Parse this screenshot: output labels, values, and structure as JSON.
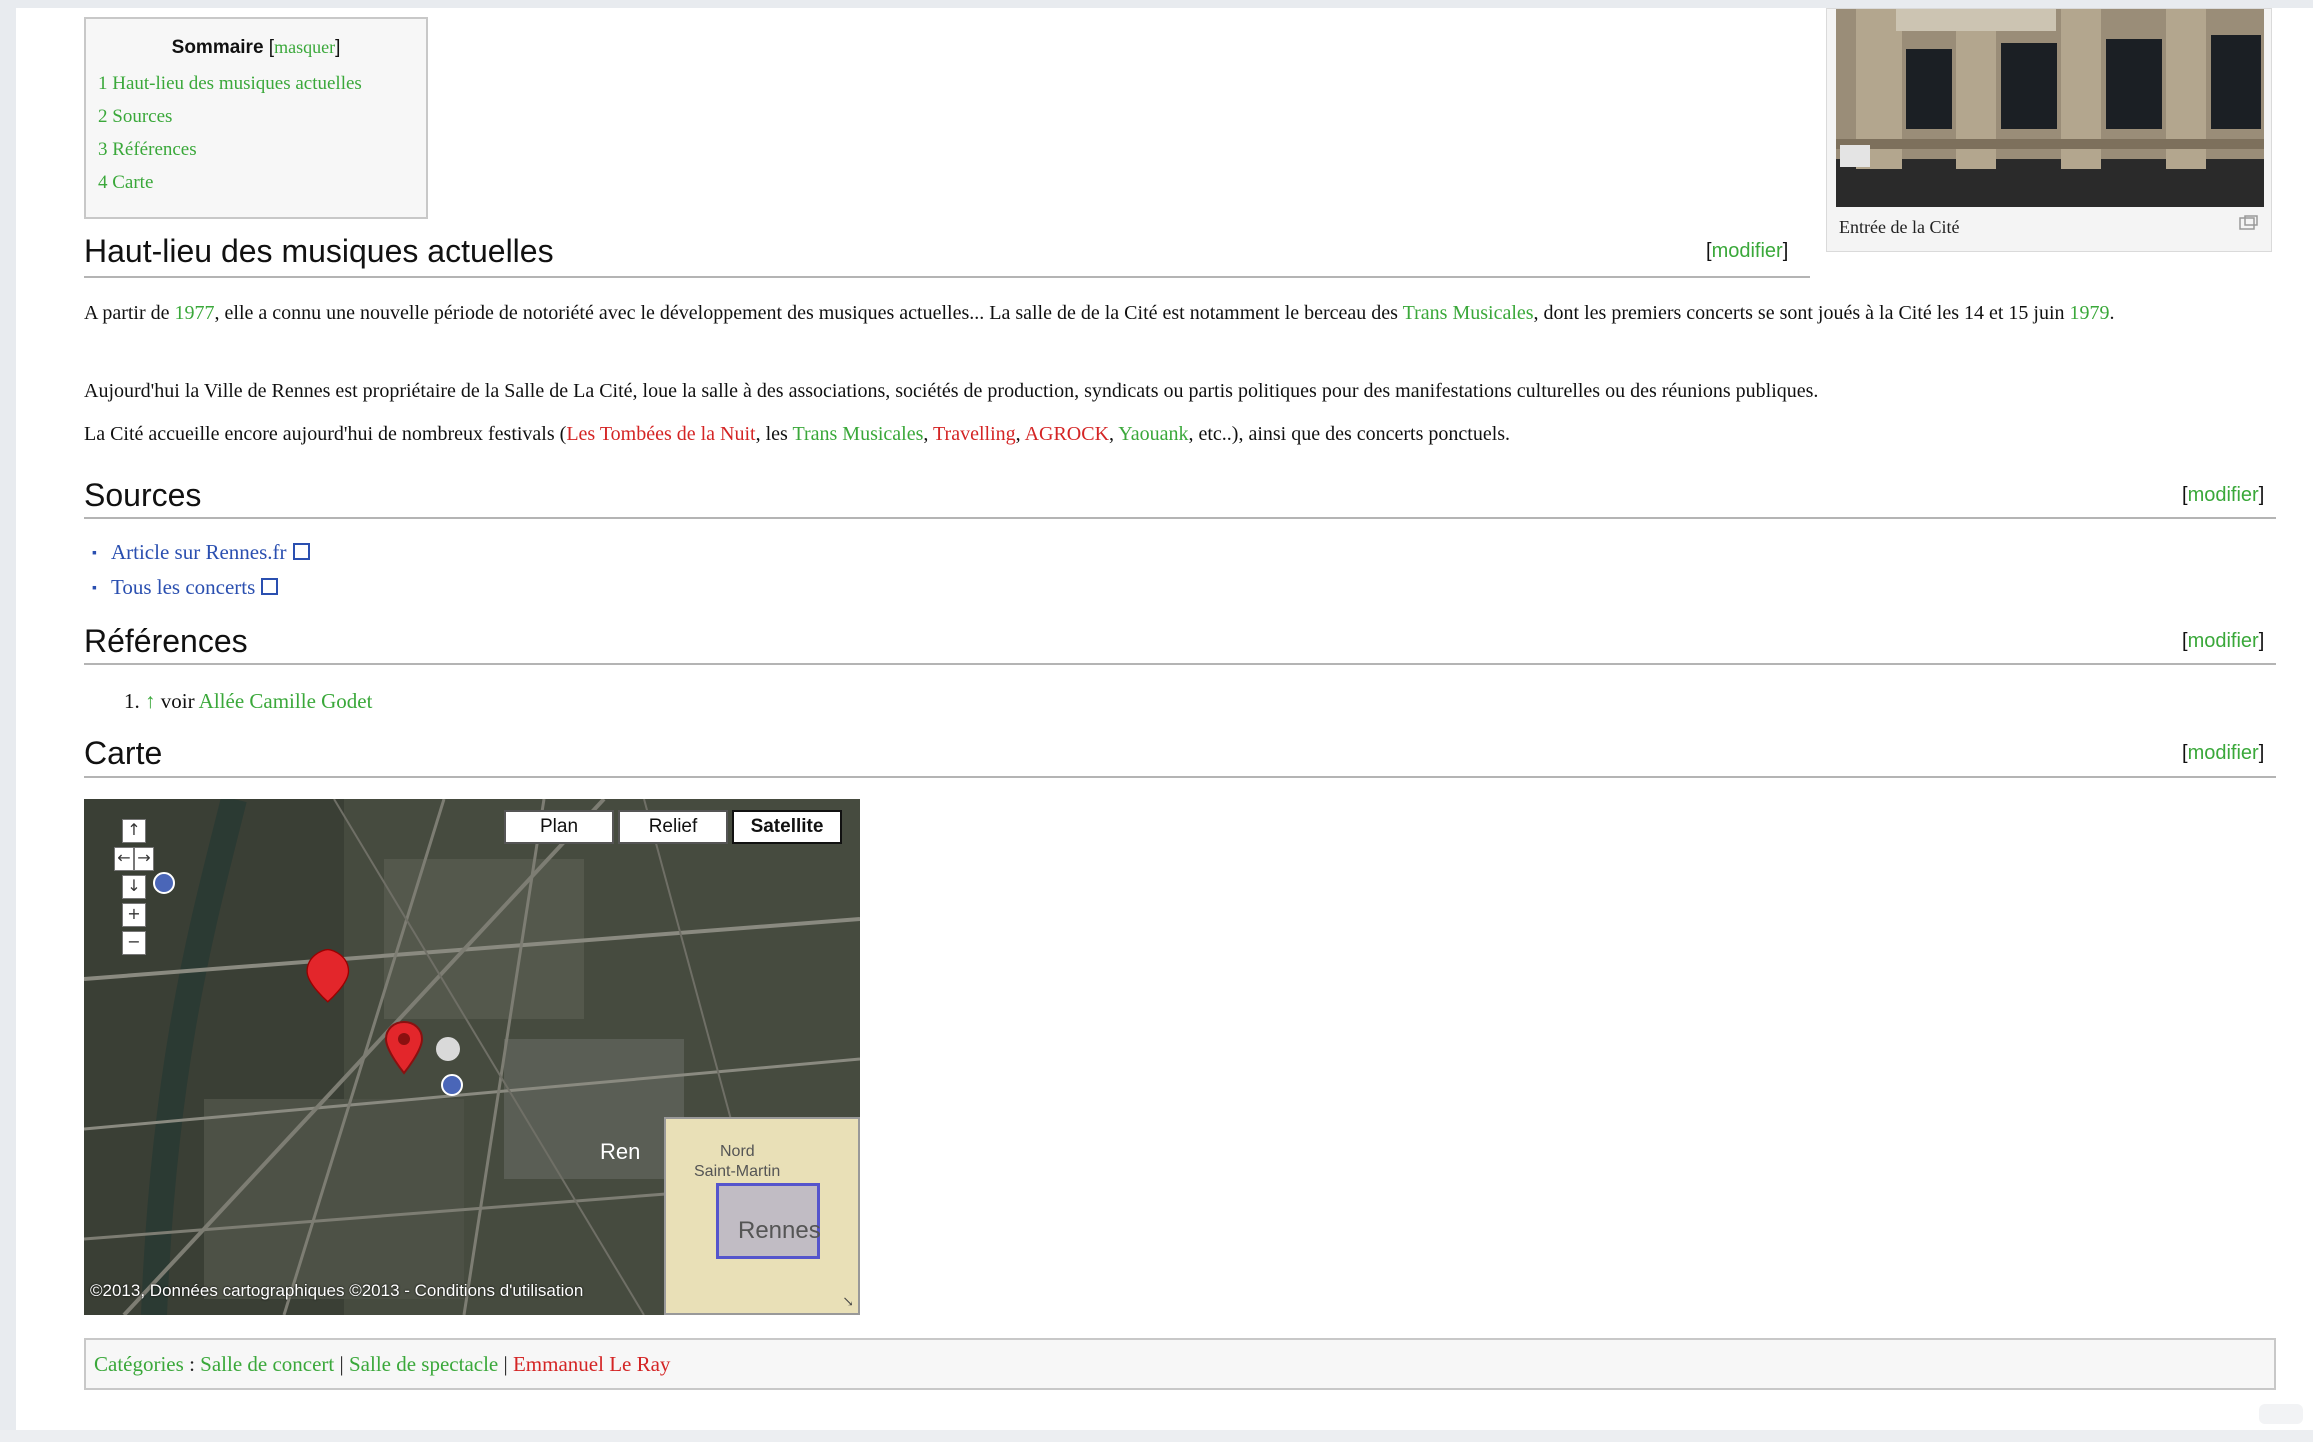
{
  "toc": {
    "title": "Sommaire",
    "hide_label": "masquer",
    "items": [
      "1 Haut-lieu des musiques actuelles",
      "2 Sources",
      "3 Références",
      "4 Carte"
    ]
  },
  "thumb": {
    "caption": "Entrée de la Cité"
  },
  "edit_label": "modifier",
  "sections": {
    "haut_lieu": {
      "title": "Haut-lieu des musiques actuelles",
      "p1": {
        "t1": "A partir de ",
        "link_1977": "1977",
        "t2": ", elle a connu une nouvelle période de notoriété avec le développement des musiques actuelles... La salle de de la Cité est notamment le berceau des ",
        "link_trans": "Trans Musicales",
        "t3": ", dont les premiers concerts se sont joués à la Cité les 14 et 15 juin ",
        "link_1979": "1979",
        "t4": "."
      },
      "p2": "Aujourd'hui la Ville de Rennes est propriétaire de la Salle de La Cité, loue la salle à des associations, sociétés de production, syndicats ou partis politiques pour des manifestations culturelles ou des réunions publiques.",
      "p3": {
        "t1": "La Cité accueille encore aujourd'hui de nombreux festivals (",
        "link_tombees": "Les Tombées de la Nuit",
        "t2": ", les ",
        "link_trans": "Trans Musicales",
        "sep1": ", ",
        "link_travelling": "Travelling",
        "sep2": ", ",
        "link_agrock": "AGROCK",
        "sep3": ", ",
        "link_yaouank": "Yaouank",
        "t3": ", etc..), ainsi que des concerts ponctuels."
      }
    },
    "sources": {
      "title": "Sources",
      "items": [
        "Article sur Rennes.fr",
        "Tous les concerts"
      ]
    },
    "references": {
      "title": "Références",
      "item_num": "1.",
      "arrow": "↑",
      "item_text": " voir ",
      "item_link": "Allée Camille Godet"
    },
    "carte": {
      "title": "Carte"
    }
  },
  "map": {
    "tabs": [
      "Plan",
      "Relief",
      "Satellite"
    ],
    "active_tab": "Satellite",
    "copyright": "©2013, Données cartographiques ©2013 - Conditions d'utilisation",
    "overview_labels": [
      "Nord",
      "Saint-Martin",
      "Rennes"
    ],
    "city_label": "Ren"
  },
  "categories": {
    "label": "Catégories",
    "colon": " : ",
    "items": [
      "Salle de concert",
      "Salle de spectacle",
      "Emmanuel Le Ray"
    ],
    "separator": " | "
  }
}
